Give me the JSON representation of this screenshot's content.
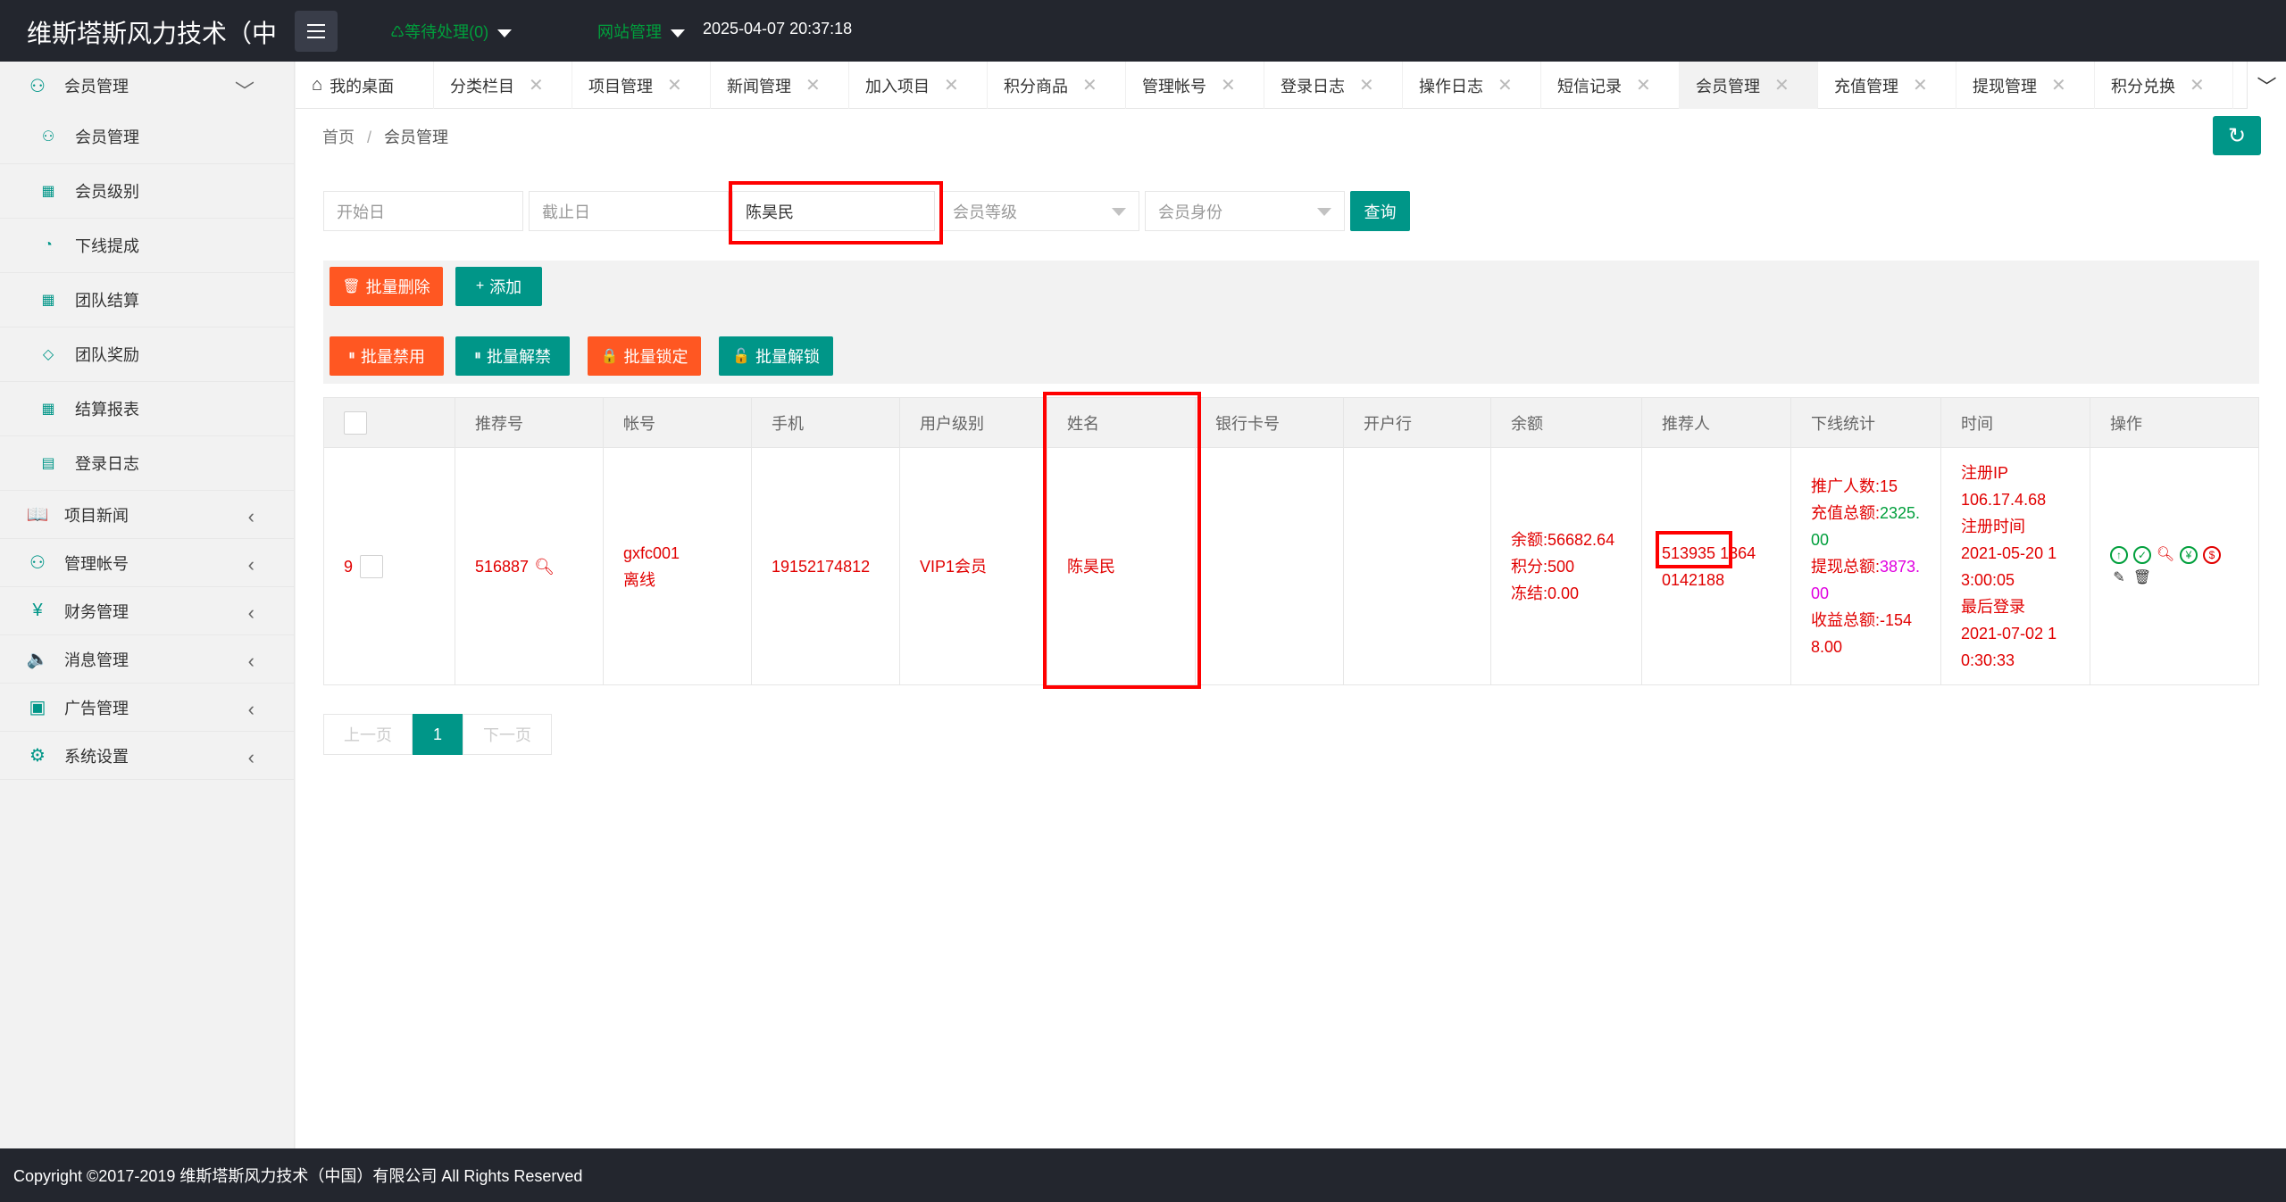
{
  "header": {
    "brand": "维斯塔斯风力技术（中",
    "pending": "♺等待处理(0)",
    "site_admin": "网站管理",
    "datetime": "2025-04-07 20:37:18"
  },
  "sidebar": {
    "member_group": "会员管理",
    "member_items": [
      "会员管理",
      "会员级别",
      "下线提成",
      "团队结算",
      "团队奖励",
      "结算报表",
      "登录日志"
    ],
    "groups": [
      "项目新闻",
      "管理帐号",
      "财务管理",
      "消息管理",
      "广告管理",
      "系统设置"
    ]
  },
  "tabs": [
    "我的桌面",
    "分类栏目",
    "项目管理",
    "新闻管理",
    "加入项目",
    "积分商品",
    "管理帐号",
    "登录日志",
    "操作日志",
    "短信记录",
    "会员管理",
    "充值管理",
    "提现管理",
    "积分兑换"
  ],
  "breadcrumb": {
    "home": "首页",
    "sep": "/",
    "current": "会员管理"
  },
  "filters": {
    "start": "开始日",
    "end": "截止日",
    "name": "陈昊民",
    "level": "会员等级",
    "identity": "会员身份",
    "query": "查询"
  },
  "toolbar": {
    "batch_delete": "批量删除",
    "add": "添加",
    "batch_disable": "批量禁用",
    "batch_unban": "批量解禁",
    "batch_lock": "批量锁定",
    "batch_unlock": "批量解锁"
  },
  "table": {
    "headers": [
      "推荐号",
      "帐号",
      "手机",
      "用户级别",
      "姓名",
      "银行卡号",
      "开户行",
      "余额",
      "推荐人",
      "下线统计",
      "时间",
      "操作"
    ],
    "row": {
      "id": "9",
      "ref_no": "516887",
      "account": "gxfc001",
      "status": "离线",
      "phone": "19152174812",
      "level": "VIP1会员",
      "name": "陈昊民",
      "balance": "余额:56682.64",
      "points": "积分:500",
      "frozen": "冻结:0.00",
      "referrer_id": "513935",
      "referrer_phone_a": "1364",
      "referrer_phone_b": "0142188",
      "promo_count": "推广人数:15",
      "recharge_label": "充值总额:",
      "recharge_val": "2325.",
      "recharge_val2": "00",
      "withdraw_label": "提现总额:",
      "withdraw_val": "3873.",
      "withdraw_val2": "00",
      "income_label": "收益总额:-154",
      "income_val2": "8.00",
      "reg_ip_label": "注册IP",
      "reg_ip": "106.17.4.68",
      "reg_time_label": "注册时间",
      "reg_time_a": "2021-05-20 1",
      "reg_time_b": "3:00:05",
      "last_login_label": "最后登录",
      "last_login_a": "2021-07-02 1",
      "last_login_b": "0:30:33"
    }
  },
  "pager": {
    "prev": "上一页",
    "page": "1",
    "next": "下一页"
  },
  "footer": "Copyright ©2017-2019 维斯塔斯风力技术（中国）有限公司 All Rights Reserved",
  "colors": {
    "accent": "#009688",
    "danger": "#ff5722",
    "red_text": "#e10000",
    "header_bg": "#23262e"
  }
}
